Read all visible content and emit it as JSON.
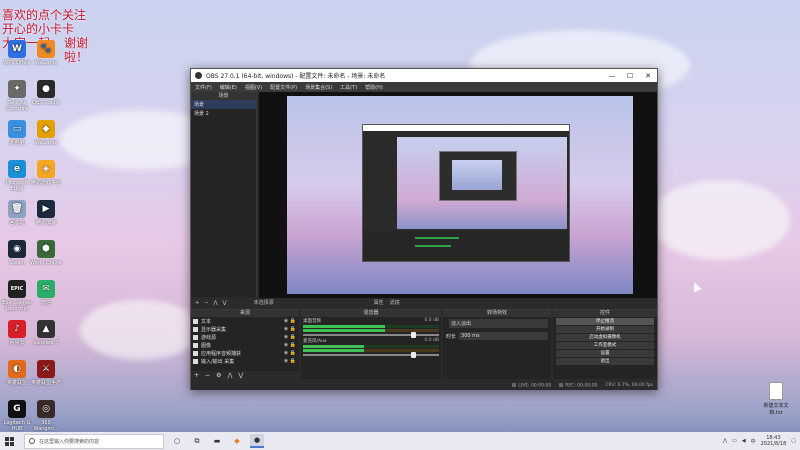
{
  "desktop": {
    "overlay_lines": [
      "喜欢的点个关注",
      "开心的小卡卡",
      "大家一起",
      "谢谢啦！"
    ],
    "icons": [
      {
        "label": "WPS Office",
        "glyph": "W",
        "color": "#2e6fe0"
      },
      {
        "label": "WeGame",
        "glyph": "🐾",
        "color": "#f08a24"
      },
      {
        "label": "Tank Ac Crossfire",
        "glyph": "✦",
        "color": "#6a6a6a"
      },
      {
        "label": "OBS Studio",
        "glyph": "●",
        "color": "#2a2a2a"
      },
      {
        "label": "此电脑",
        "glyph": "▭",
        "color": "#3b8fe0"
      },
      {
        "label": "WeGame",
        "glyph": "◆",
        "color": "#e2a100"
      },
      {
        "label": "Microsoft Edge",
        "glyph": "e",
        "color": "#1a8fd6"
      },
      {
        "label": "腾讯游戏平台",
        "glyph": "◈",
        "color": "#f5a623"
      },
      {
        "label": "回收站",
        "glyph": "🗑",
        "color": "#8fa2c2"
      },
      {
        "label": "腾讯加速",
        "glyph": "▶",
        "color": "#1c2a40"
      },
      {
        "label": "Steam",
        "glyph": "◉",
        "color": "#1b2838"
      },
      {
        "label": "World Online",
        "glyph": "⬢",
        "color": "#3a6a3a"
      },
      {
        "label": "Epic Games Launcher",
        "glyph": "EPIC",
        "color": "#222222"
      },
      {
        "label": "微信",
        "glyph": "✉",
        "color": "#2aae67"
      },
      {
        "label": "网易云",
        "glyph": "♪",
        "color": "#d81e27"
      },
      {
        "label": "Valorant 7",
        "glyph": "▲",
        "color": "#333333"
      },
      {
        "label": "英雄联盟",
        "glyph": "◐",
        "color": "#e06a1a"
      },
      {
        "label": "英雄联盟手游",
        "glyph": "⚔",
        "color": "#8a1a1a"
      },
      {
        "label": "Logitech G HUB",
        "glyph": "G",
        "color": "#111111"
      },
      {
        "label": "360 Wangmi...",
        "glyph": "◎",
        "color": "#3a2a2a"
      }
    ],
    "file_label": "新建文本文档.txt"
  },
  "obs": {
    "title": "OBS 27.0.1 (64-bit, windows) - 配置文件: 未命名 - 场景: 未命名",
    "menu": [
      "文件(F)",
      "编辑(E)",
      "视图(V)",
      "配置文件(P)",
      "场景集合(S)",
      "工具(T)",
      "帮助(H)"
    ],
    "scenes_header": "场景",
    "scenes": [
      "场景",
      "场景 2"
    ],
    "preview_bar": {
      "source_label": "未选择源",
      "properties": "属性",
      "filters": "滤镜"
    },
    "sources_header": "来源",
    "sources": [
      "文本",
      "显示器采集",
      "游戏源",
      "图像",
      "应用程序音频捕获",
      "输入/输出 采集"
    ],
    "mixer_header": "混音器",
    "mixer": [
      {
        "name": "桌面音频",
        "level": "0.0 dB",
        "fill": 0.6
      },
      {
        "name": "麦克风/Aux",
        "level": "0.0 dB",
        "fill": 0.45
      }
    ],
    "transitions_header": "转场特效",
    "transitions": {
      "type": "淡入淡出",
      "duration_label": "时长",
      "duration": "300 ms"
    },
    "controls_header": "控件",
    "controls": [
      "停止推流",
      "开始录制",
      "启动虚拟摄像机",
      "工作室模式",
      "设置",
      "退出"
    ],
    "status": {
      "live": "LIVE: 00:00:00",
      "rec": "REC: 00:00:00",
      "cpu": "CPU: 0.7%, 60.00 fps"
    }
  },
  "taskbar": {
    "search_placeholder": "在这里输入你要搜索的内容",
    "time": "18:43",
    "date": "2021/8/18",
    "lang": "中"
  }
}
